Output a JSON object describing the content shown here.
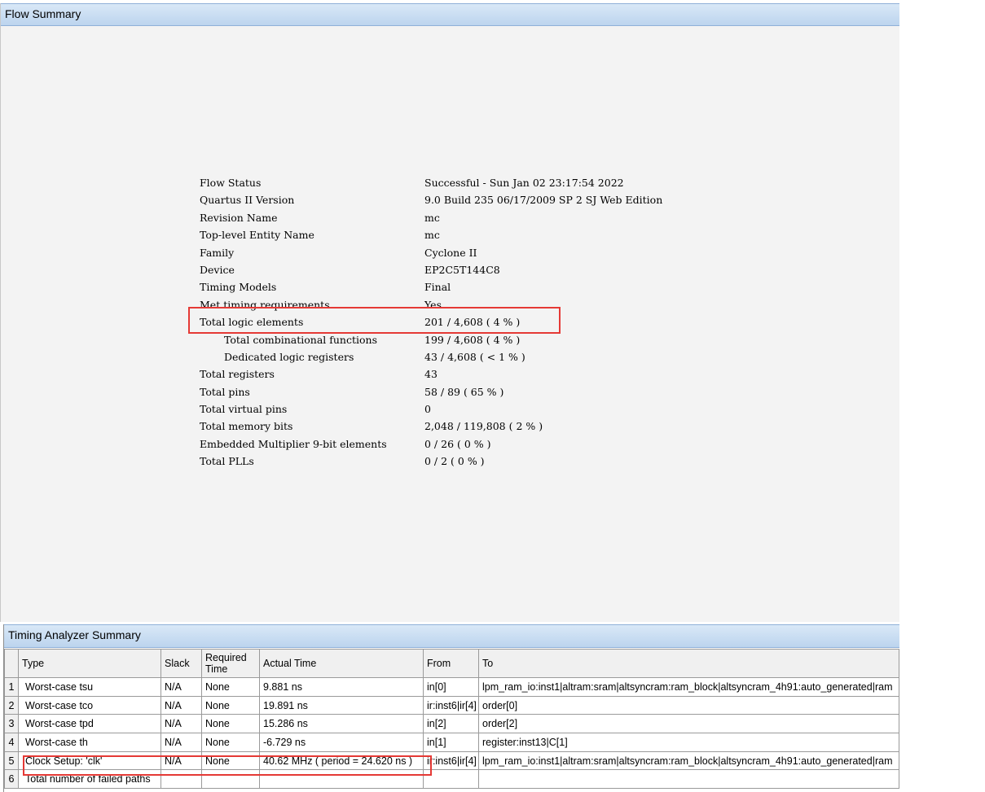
{
  "flow_summary": {
    "title": "Flow Summary",
    "rows": [
      {
        "label": "Flow Status",
        "value": "Successful - Sun Jan 02 23:17:54 2022",
        "indent": false
      },
      {
        "label": "Quartus II Version",
        "value": "9.0 Build 235 06/17/2009 SP 2 SJ Web Edition",
        "indent": false
      },
      {
        "label": "Revision Name",
        "value": "mc",
        "indent": false
      },
      {
        "label": "Top-level Entity Name",
        "value": "mc",
        "indent": false
      },
      {
        "label": "Family",
        "value": "Cyclone II",
        "indent": false
      },
      {
        "label": "Device",
        "value": "EP2C5T144C8",
        "indent": false
      },
      {
        "label": "Timing Models",
        "value": "Final",
        "indent": false
      },
      {
        "label": "Met timing requirements",
        "value": "Yes",
        "indent": false
      },
      {
        "label": "Total logic elements",
        "value": "201 / 4,608 ( 4 % )",
        "indent": false
      },
      {
        "label": "Total combinational functions",
        "value": "199 / 4,608 ( 4 % )",
        "indent": true
      },
      {
        "label": "Dedicated logic registers",
        "value": "43 / 4,608 ( < 1 % )",
        "indent": true
      },
      {
        "label": "Total registers",
        "value": "43",
        "indent": false
      },
      {
        "label": "Total pins",
        "value": "58 / 89 ( 65 % )",
        "indent": false
      },
      {
        "label": "Total virtual pins",
        "value": "0",
        "indent": false
      },
      {
        "label": "Total memory bits",
        "value": "2,048 / 119,808 ( 2 % )",
        "indent": false
      },
      {
        "label": "Embedded Multiplier 9-bit elements",
        "value": "0 / 26 ( 0 % )",
        "indent": false
      },
      {
        "label": "Total PLLs",
        "value": "0 / 2 ( 0 % )",
        "indent": false
      }
    ]
  },
  "timing_summary": {
    "title": "Timing Analyzer Summary",
    "columns": [
      "",
      "Type",
      "Slack",
      "Required Time",
      "Actual Time",
      "From",
      "To"
    ],
    "rows": [
      {
        "num": "1",
        "type": "Worst-case tsu",
        "slack": "N/A",
        "required": "None",
        "actual": "9.881 ns",
        "from": "in[0]",
        "to": "lpm_ram_io:inst1|altram:sram|altsyncram:ram_block|altsyncram_4h91:auto_generated|ram"
      },
      {
        "num": "2",
        "type": "Worst-case tco",
        "slack": "N/A",
        "required": "None",
        "actual": "19.891 ns",
        "from": "ir:inst6|ir[4]",
        "to": "order[0]"
      },
      {
        "num": "3",
        "type": "Worst-case tpd",
        "slack": "N/A",
        "required": "None",
        "actual": "15.286 ns",
        "from": "in[2]",
        "to": "order[2]"
      },
      {
        "num": "4",
        "type": "Worst-case th",
        "slack": "N/A",
        "required": "None",
        "actual": "-6.729 ns",
        "from": "in[1]",
        "to": "register:inst13|C[1]"
      },
      {
        "num": "5",
        "type": "Clock Setup: 'clk'",
        "slack": "N/A",
        "required": "None",
        "actual": "40.62 MHz ( period = 24.620 ns )",
        "from": "ir:inst6|ir[4]",
        "to": "lpm_ram_io:inst1|altram:sram|altsyncram:ram_block|altsyncram_4h91:auto_generated|ram"
      },
      {
        "num": "6",
        "type": "Total number of failed paths",
        "slack": "",
        "required": "",
        "actual": "",
        "from": "",
        "to": ""
      }
    ]
  },
  "colors": {
    "header_gradient_top": "#d9e8f7",
    "header_gradient_bottom": "#bcd4ee",
    "highlight": "#e53935",
    "panel_bg": "#f3f3f3"
  }
}
